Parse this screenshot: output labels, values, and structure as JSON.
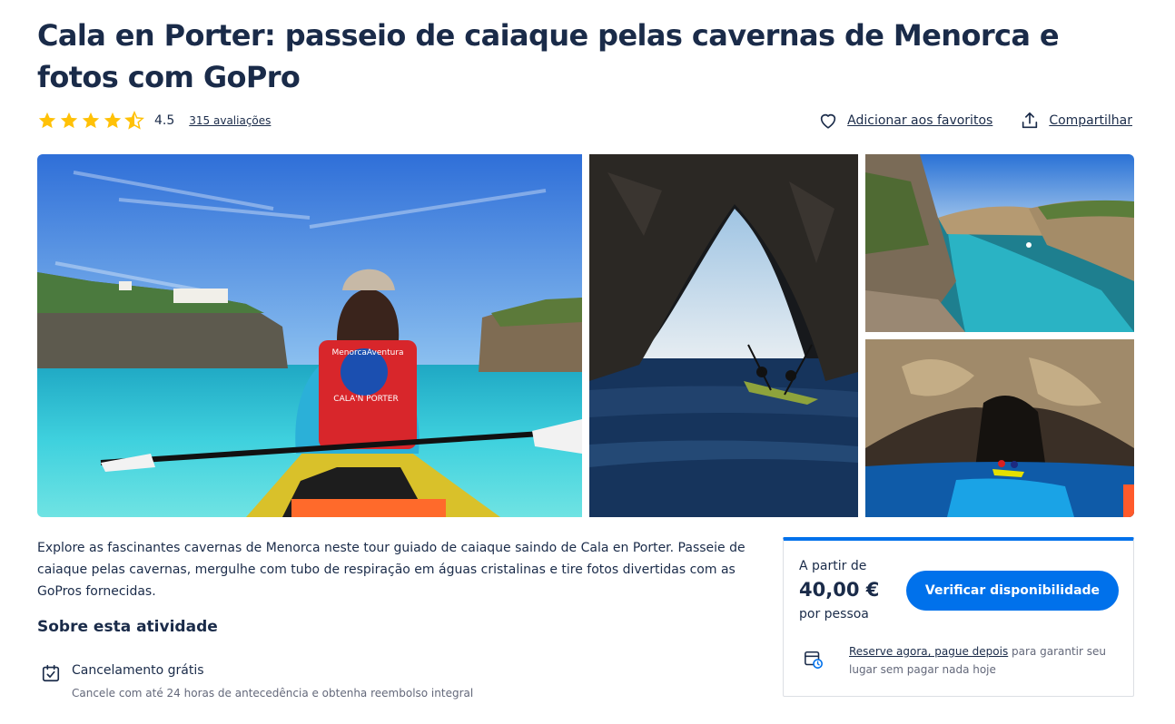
{
  "title": "Cala en Porter: passeio de caiaque pelas cavernas de Menorca e fotos com GoPro",
  "rating": {
    "value": "4.5",
    "stars_shown": 4.5,
    "reviews_label": "315 avaliações",
    "star_color": "#ffc107"
  },
  "actions": {
    "favorite_label": "Adicionar aos favoritos",
    "share_label": "Compartilhar",
    "favorite_icon": "heart-icon",
    "share_icon": "share-icon"
  },
  "gallery": {
    "photos": [
      "kayaker-in-red-life-vest-photo",
      "sea-cave-arch-photo",
      "cala-inlet-photo",
      "cave-kayak-photo"
    ],
    "overlay_text": {
      "vest_top": "MenorcaAventura",
      "vest_bottom": "CALA'N PORTER"
    }
  },
  "description": "Explore as fascinantes cavernas de Menorca neste tour guiado de caiaque saindo de Cala en Porter. Passeie de caiaque pelas cavernas, mergulhe com tubo de respiração em águas cristalinas e tire fotos divertidas com as GoPros fornecidas.",
  "about": {
    "title": "Sobre esta atividade",
    "features": [
      {
        "icon": "calendar-check-icon",
        "title": "Cancelamento grátis",
        "subtitle": "Cancele com até 24 horas de antecedência e obtenha reembolso integral"
      }
    ]
  },
  "booking": {
    "from_label": "A partir de",
    "price": "40,00 €",
    "per_label": "por pessoa",
    "button_label": "Verificar disponibilidade",
    "reserve_link": "Reserve agora, pague depois",
    "reserve_text": " para garantir seu lugar sem pagar nada hoje",
    "accent_color": "#0071eb"
  }
}
